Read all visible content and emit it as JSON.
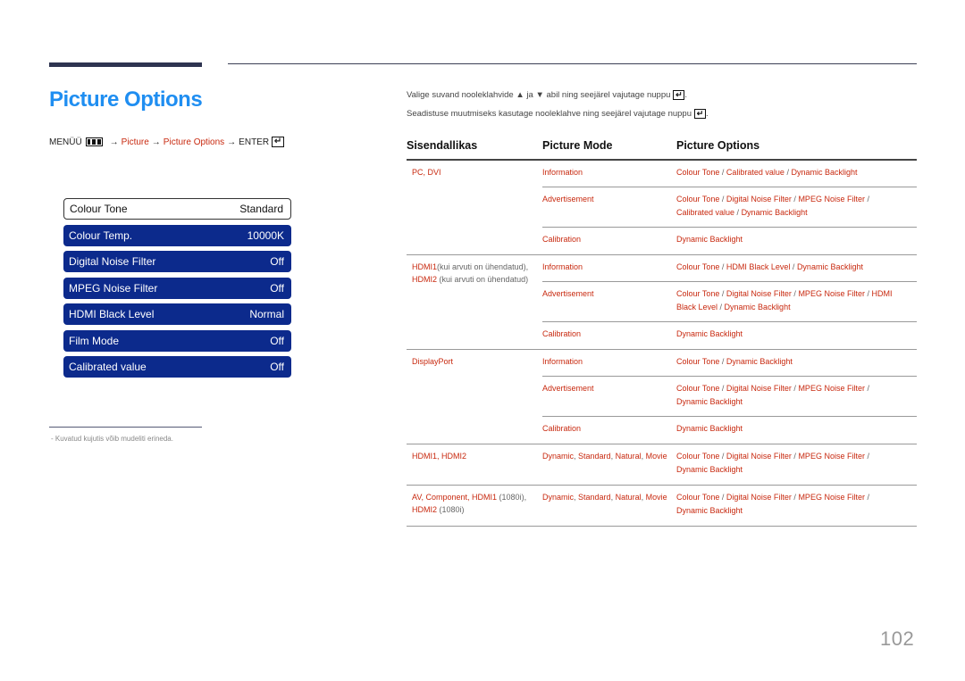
{
  "page": {
    "title": "Picture Options",
    "page_number": "102"
  },
  "menu_path": {
    "menu_label": "MENÜÜ",
    "menu_icon": "menu-icon",
    "arrow": "→",
    "step1": "Picture",
    "step2": "Picture Options",
    "enter_label": "ENTER",
    "enter_icon": "enter-icon"
  },
  "osd": {
    "items": [
      {
        "label": "Colour Tone",
        "value": "Standard",
        "selected": true
      },
      {
        "label": "Colour Temp.",
        "value": "10000K",
        "selected": false
      },
      {
        "label": "Digital Noise Filter",
        "value": "Off",
        "selected": false
      },
      {
        "label": "MPEG Noise Filter",
        "value": "Off",
        "selected": false
      },
      {
        "label": "HDMI Black Level",
        "value": "Normal",
        "selected": false
      },
      {
        "label": "Film Mode",
        "value": "Off",
        "selected": false
      },
      {
        "label": "Calibrated value",
        "value": "Off",
        "selected": false
      }
    ]
  },
  "footnote": "- Kuvatud kujutis võib mudeliti erineda.",
  "instructions": {
    "line1_a": "Valige suvand nooleklahvide",
    "up_arrow": "▲",
    "line1_b": "ja",
    "down_arrow": "▼",
    "line1_c": "abil ning seejärel vajutage nuppu",
    "line2": "Seadistuse muutmiseks kasutage nooleklahve ning seejärel vajutage nuppu",
    "enter_glyph": "↵"
  },
  "table": {
    "headers": [
      "Sisendallikas",
      "Picture Mode",
      "Picture Options"
    ],
    "groups": [
      {
        "source": [
          {
            "t": "PC, DVI",
            "c": "red"
          }
        ],
        "modes": [
          {
            "mode": "Information",
            "options": "Colour Tone / Calibrated value / Dynamic Backlight"
          },
          {
            "mode": "Advertisement",
            "options": "Colour Tone / Digital Noise Filter / MPEG Noise Filter / Calibrated value / Dynamic Backlight"
          },
          {
            "mode": "Calibration",
            "options": "Dynamic Backlight"
          }
        ]
      },
      {
        "source": [
          {
            "t": "HDMI1",
            "c": "red"
          },
          {
            "t": "(kui arvuti on ühendatud), ",
            "c": "gray"
          },
          {
            "t": "HDMI2",
            "c": "red"
          },
          {
            "t": " (kui arvuti on ühendatud)",
            "c": "gray"
          }
        ],
        "modes": [
          {
            "mode": "Information",
            "options": "Colour Tone / HDMI Black Level / Dynamic Backlight"
          },
          {
            "mode": "Advertisement",
            "options": "Colour Tone / Digital Noise Filter / MPEG Noise Filter / HDMI Black Level / Dynamic Backlight"
          },
          {
            "mode": "Calibration",
            "options": "Dynamic Backlight"
          }
        ]
      },
      {
        "source": [
          {
            "t": "DisplayPort",
            "c": "red"
          }
        ],
        "modes": [
          {
            "mode": "Information",
            "options": "Colour Tone / Dynamic Backlight"
          },
          {
            "mode": "Advertisement",
            "options": "Colour Tone / Digital Noise Filter / MPEG Noise Filter / Dynamic Backlight"
          },
          {
            "mode": "Calibration",
            "options": "Dynamic Backlight"
          }
        ]
      },
      {
        "source": [
          {
            "t": "HDMI1, HDMI2",
            "c": "red"
          }
        ],
        "modes": [
          {
            "mode": "Dynamic, Standard, Natural, Movie",
            "options": "Colour Tone / Digital Noise Filter / MPEG Noise Filter / Dynamic Backlight"
          }
        ]
      },
      {
        "source": [
          {
            "t": "AV, Component, HDMI1",
            "c": "red"
          },
          {
            "t": " (1080i), ",
            "c": "gray"
          },
          {
            "t": "HDMI2",
            "c": "red"
          },
          {
            "t": " (1080i)",
            "c": "gray"
          }
        ],
        "modes": [
          {
            "mode": "Dynamic, Standard, Natural, Movie",
            "options": "Colour Tone / Digital Noise Filter / MPEG Noise Filter / Dynamic Backlight"
          }
        ]
      }
    ]
  }
}
